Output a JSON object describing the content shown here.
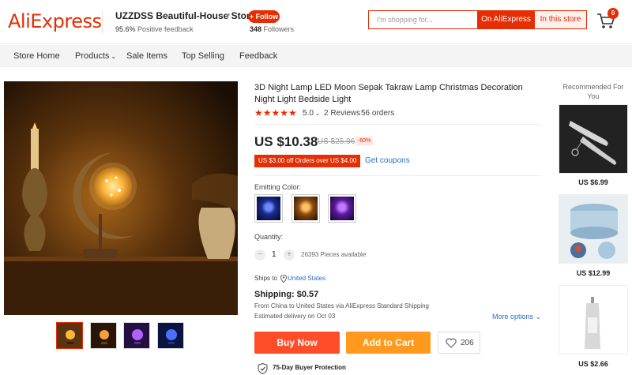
{
  "header": {
    "logo": "AliExpress",
    "store_name": "UZZDSS Beautiful-House Store",
    "feedback_percent": "95.6%",
    "feedback_label": "Positive feedback",
    "follow_label": "+ Follow",
    "followers_count": "348",
    "followers_label": "Followers",
    "search_placeholder": "I'm shopping for...",
    "search_ali_label": "On AliExpress",
    "search_store_label": "In this store",
    "cart_count": "0"
  },
  "nav": {
    "items": [
      "Store Home",
      "Products",
      "Sale Items",
      "Top Selling",
      "Feedback"
    ]
  },
  "product": {
    "title": "3D Night Lamp LED Moon Sepak Takraw Lamp Christmas Decoration Night Light Bedside Light",
    "stars": "★★★★★",
    "rating": "5.0",
    "reviews": "2 Reviews",
    "orders": "56 orders",
    "price": "US $10.38",
    "old_price": "US $25.96",
    "discount": "-60%",
    "coupon": "US $3.00 off Orders over US $4.00",
    "coupon_link": "Get coupons",
    "color_label": "Emitting Color:",
    "quantity_label": "Quantity:",
    "quantity": "1",
    "qty_minus": "−",
    "qty_plus": "+",
    "available": "26393 Pieces available",
    "ships_to_label": "Ships to",
    "ships_to_country": "United States",
    "shipping": "Shipping: $0.57",
    "shipping_from": "From China to United States via AliExpress Standard Shipping",
    "delivery": "Estimated delivery on Oct 03",
    "more_options": "More options",
    "buy_now": "Buy Now",
    "add_to_cart": "Add to Cart",
    "wishlist_count": "206",
    "protection": "75-Day Buyer Protection"
  },
  "recommend": {
    "title": "Recommended For You",
    "items": [
      {
        "price": "US $6.99"
      },
      {
        "price": "US $12.99"
      },
      {
        "price": "US $2.66"
      }
    ]
  },
  "colors": {
    "brand": "#e62e04",
    "buy": "#ff4d2a",
    "cart": "#ff9a1f",
    "link": "#2b6ec6"
  }
}
